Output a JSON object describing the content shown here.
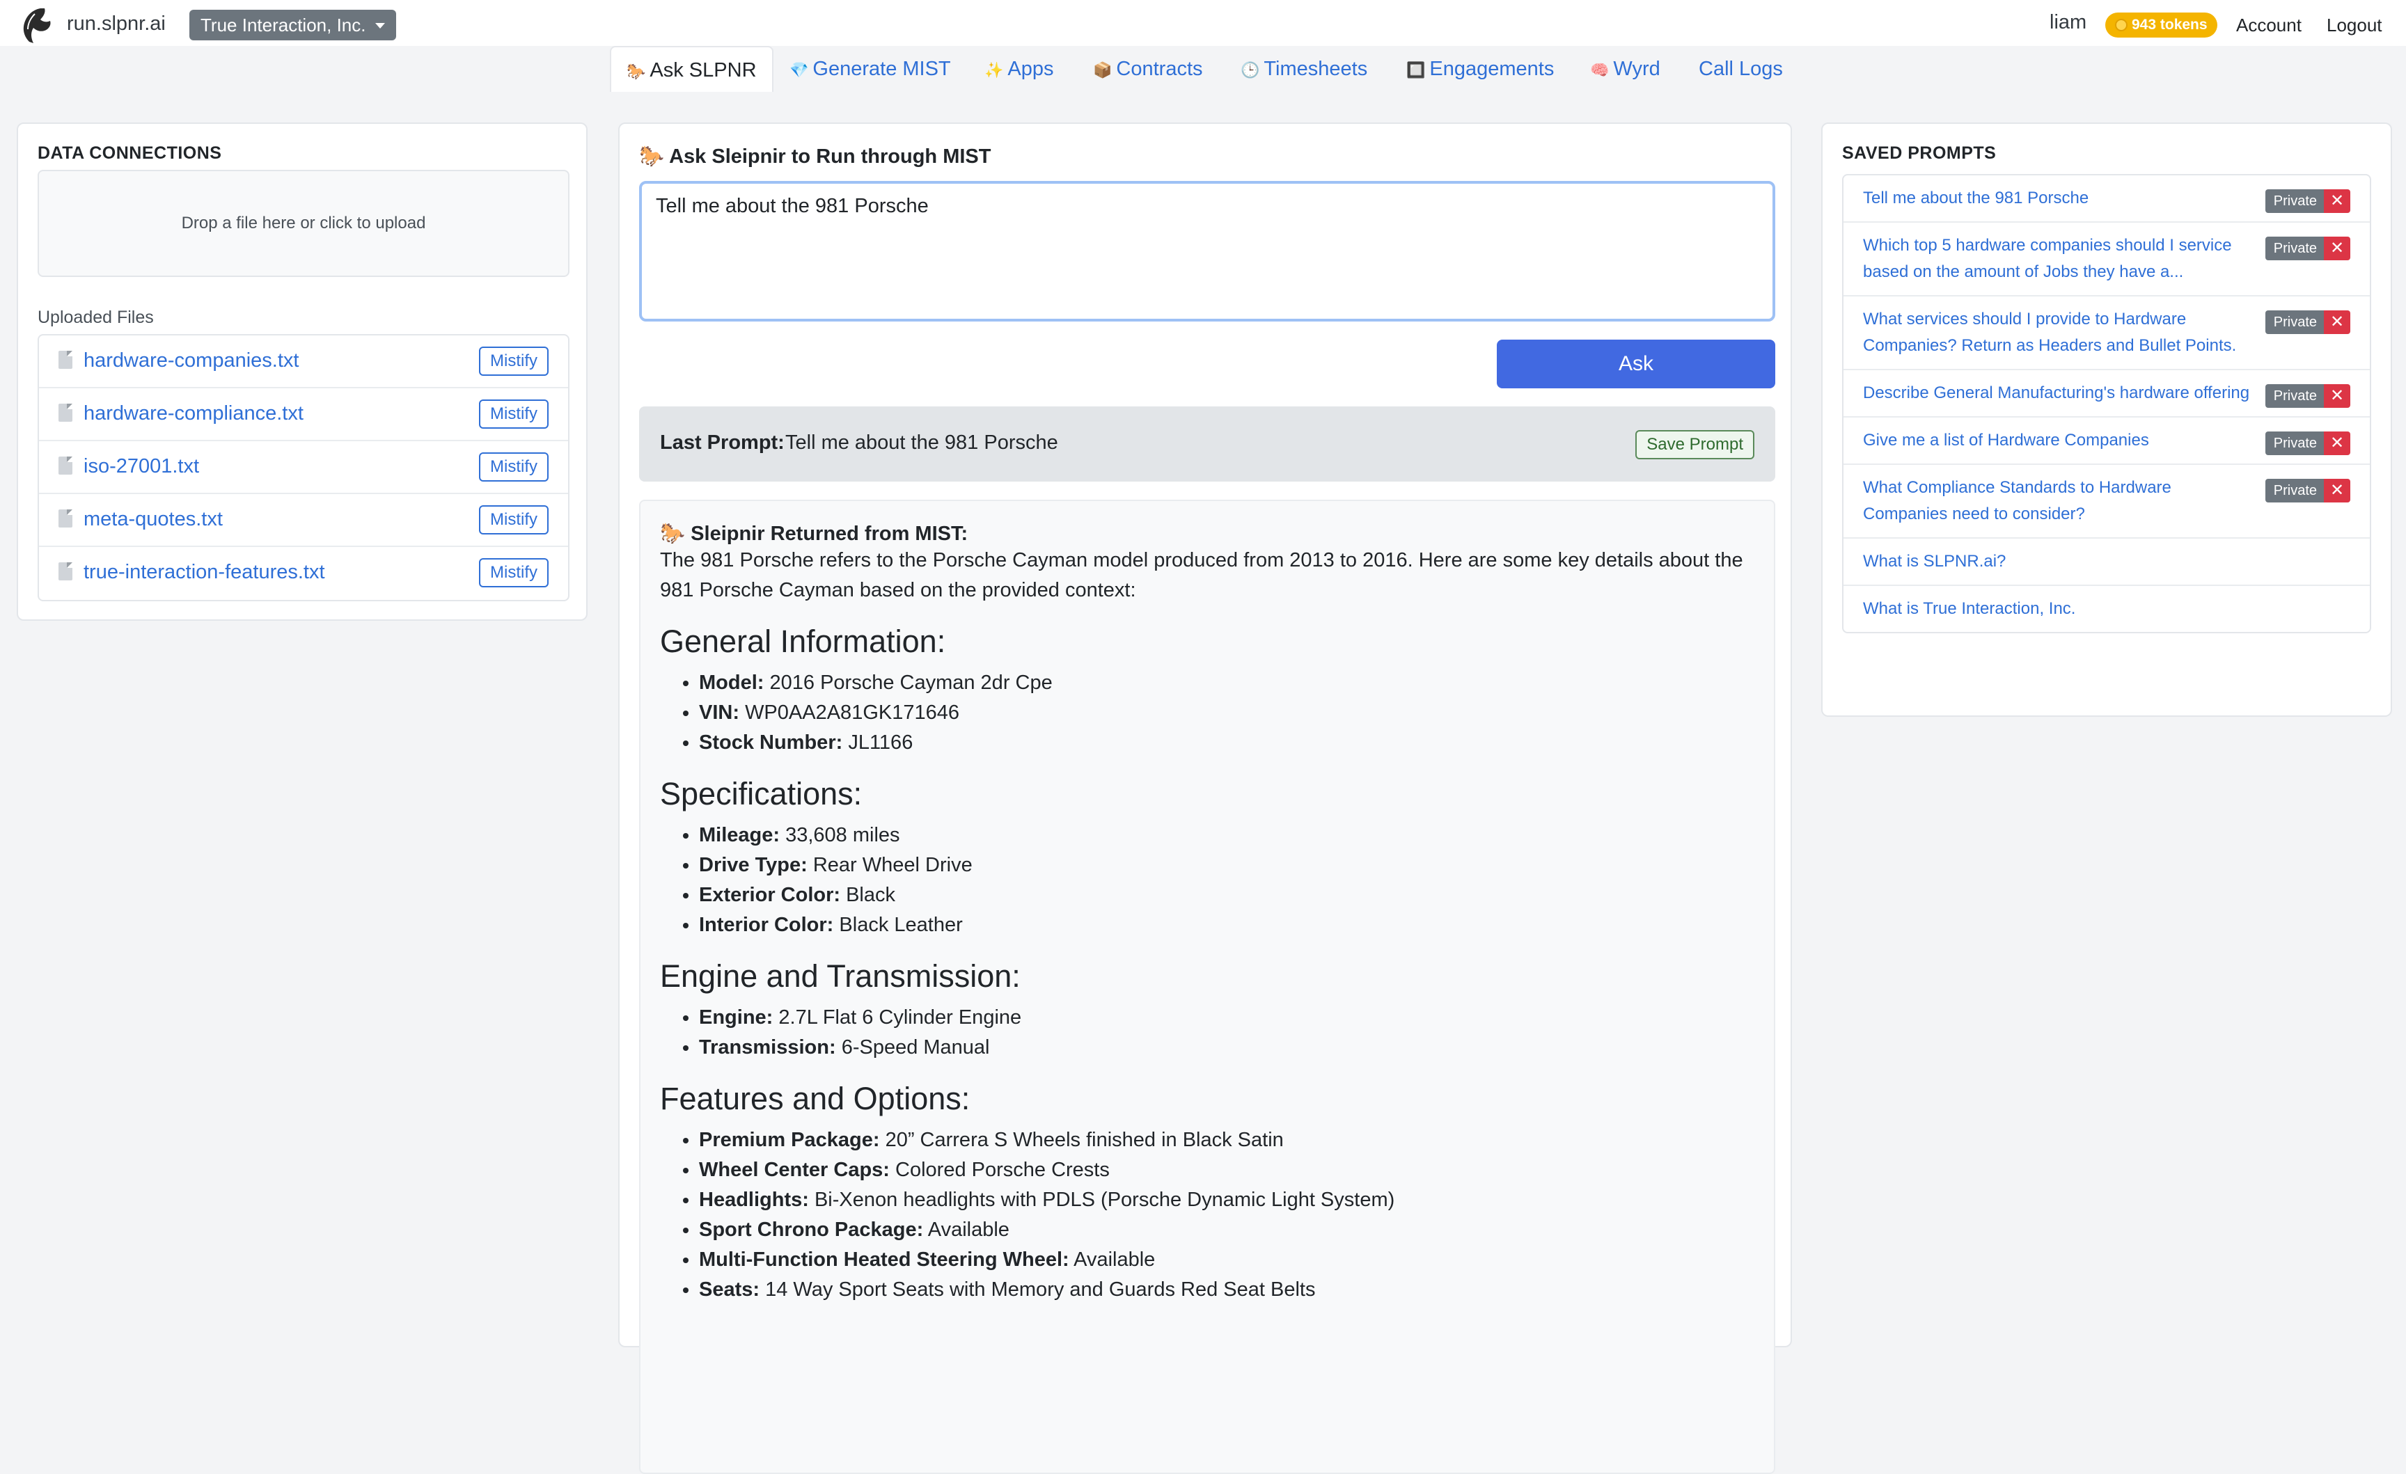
{
  "header": {
    "site_name": "run.slpnr.ai",
    "org_select": "True Interaction, Inc.",
    "username": "liam",
    "tokens": "943 tokens",
    "account_label": "Account",
    "logout_label": "Logout",
    "logo_icon": "horse-head-icon"
  },
  "tabs": [
    {
      "label": "Ask SLPNR",
      "icon": "🐎",
      "active": true
    },
    {
      "label": "Generate MIST",
      "icon": "💎"
    },
    {
      "label": "Apps",
      "icon": "✨"
    },
    {
      "label": "Contracts",
      "icon": "📦"
    },
    {
      "label": "Timesheets",
      "icon": "🕒"
    },
    {
      "label": "Engagements",
      "icon": "🔲"
    },
    {
      "label": "Wyrd",
      "icon": "🧠"
    },
    {
      "label": "Call Logs",
      "icon": ""
    }
  ],
  "data_connections": {
    "title": "DATA CONNECTIONS",
    "dropzone": "Drop a file here or click to upload",
    "uploaded_label": "Uploaded Files",
    "mistify_label": "Mistify",
    "files": [
      "hardware-companies.txt",
      "hardware-compliance.txt",
      "iso-27001.txt",
      "meta-quotes.txt",
      "true-interaction-features.txt"
    ]
  },
  "ask": {
    "icon": "🐎",
    "title": "Ask Sleipnir to Run through MIST",
    "input_value": "Tell me about the 981 Porsche",
    "ask_button": "Ask",
    "last_prompt_label": "Last Prompt:",
    "last_prompt_value": "Tell me about the 981 Porsche",
    "save_prompt_label": "Save Prompt"
  },
  "response": {
    "icon": "🐎",
    "header": "Sleipnir Returned from MIST:",
    "intro": "The 981 Porsche refers to the Porsche Cayman model produced from 2013 to 2016. Here are some key details about the 981 Porsche Cayman based on the provided context:",
    "sections": [
      {
        "heading": "General Information:",
        "items": [
          {
            "k": "Model:",
            "v": "2016 Porsche Cayman 2dr Cpe"
          },
          {
            "k": "VIN:",
            "v": "WP0AA2A81GK171646"
          },
          {
            "k": "Stock Number:",
            "v": "JL1166"
          }
        ]
      },
      {
        "heading": "Specifications:",
        "items": [
          {
            "k": "Mileage:",
            "v": "33,608 miles"
          },
          {
            "k": "Drive Type:",
            "v": "Rear Wheel Drive"
          },
          {
            "k": "Exterior Color:",
            "v": "Black"
          },
          {
            "k": "Interior Color:",
            "v": "Black Leather"
          }
        ]
      },
      {
        "heading": "Engine and Transmission:",
        "items": [
          {
            "k": "Engine:",
            "v": "2.7L Flat 6 Cylinder Engine"
          },
          {
            "k": "Transmission:",
            "v": "6-Speed Manual"
          }
        ]
      },
      {
        "heading": "Features and Options:",
        "items": [
          {
            "k": "Premium Package:",
            "v": "20” Carrera S Wheels finished in Black Satin"
          },
          {
            "k": "Wheel Center Caps:",
            "v": "Colored Porsche Crests"
          },
          {
            "k": "Headlights:",
            "v": "Bi-Xenon headlights with PDLS (Porsche Dynamic Light System)"
          },
          {
            "k": "Sport Chrono Package:",
            "v": "Available"
          },
          {
            "k": "Multi-Function Heated Steering Wheel:",
            "v": "Available"
          },
          {
            "k": "Seats:",
            "v": "14 Way Sport Seats with Memory and Guards Red Seat Belts"
          }
        ]
      }
    ]
  },
  "saved_prompts": {
    "title": "SAVED PROMPTS",
    "private_label": "Private",
    "delete_label": "✕",
    "items": [
      {
        "text": "Tell me about the 981 Porsche",
        "private": true
      },
      {
        "text": "Which top 5 hardware companies should I service based on the amount of Jobs they have a...",
        "private": true
      },
      {
        "text": "What services should I provide to Hardware Companies? Return as Headers and Bullet Points.",
        "private": true
      },
      {
        "text": "Describe General Manufacturing's hardware offering",
        "private": true
      },
      {
        "text": "Give me a list of Hardware Companies",
        "private": true
      },
      {
        "text": "What Compliance Standards to Hardware Companies need to consider?",
        "private": true
      },
      {
        "text": "What is SLPNR.ai?",
        "private": false
      },
      {
        "text": "What is True Interaction, Inc.",
        "private": false
      }
    ]
  },
  "colors": {
    "link": "#2f6fd6",
    "ask_button": "#4169e1",
    "tokens_badge": "#f4b400",
    "delete": "#dc3545"
  }
}
